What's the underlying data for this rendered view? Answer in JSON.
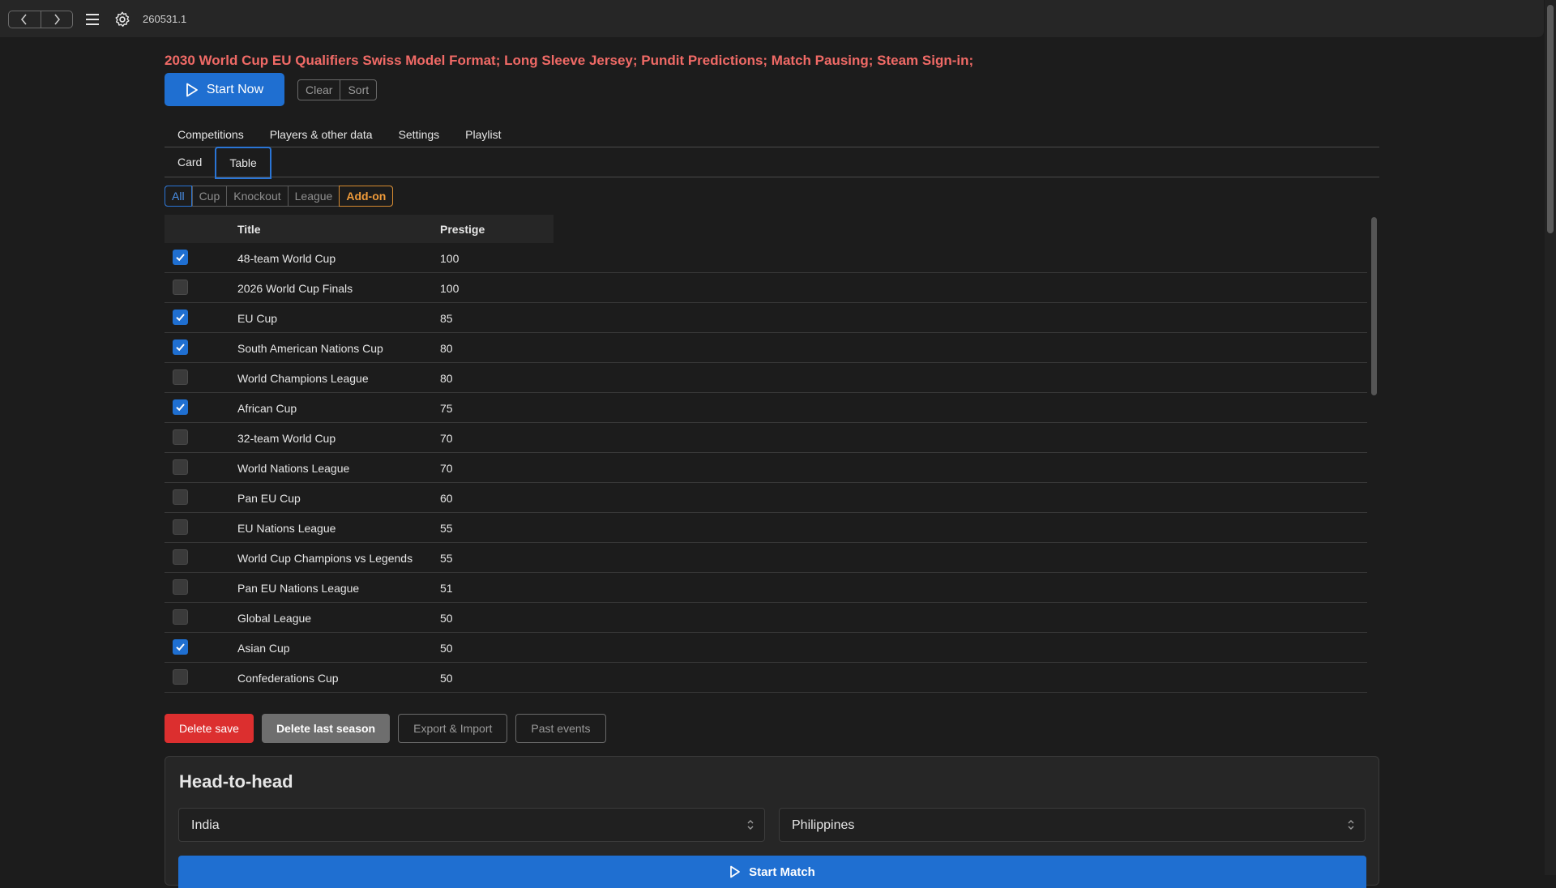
{
  "topbar": {
    "version": "260531.1",
    "icons": [
      "back-icon",
      "forward-icon",
      "menu-icon",
      "gear-icon"
    ]
  },
  "headline": "2030 World Cup EU Qualifiers Swiss Model Format; Long Sleeve Jersey; Pundit Predictions; Match Pausing; Steam Sign-in;",
  "toolbar": {
    "start_now_label": "Start Now",
    "clear_label": "Clear",
    "sort_label": "Sort"
  },
  "tabs": [
    "Competitions",
    "Players & other data",
    "Settings",
    "Playlist"
  ],
  "subtabs": [
    "Card",
    "Table"
  ],
  "active_subtab": "Table",
  "filters": [
    "All",
    "Cup",
    "Knockout",
    "League",
    "Add-on"
  ],
  "table": {
    "columns": [
      "Title",
      "Prestige"
    ],
    "rows": [
      {
        "title": "48-team World Cup",
        "prestige": "100",
        "checked": true
      },
      {
        "title": "2026 World Cup Finals",
        "prestige": "100",
        "checked": false
      },
      {
        "title": "EU Cup",
        "prestige": "85",
        "checked": true
      },
      {
        "title": "South American Nations Cup",
        "prestige": "80",
        "checked": true
      },
      {
        "title": "World Champions League",
        "prestige": "80",
        "checked": false
      },
      {
        "title": "African Cup",
        "prestige": "75",
        "checked": true
      },
      {
        "title": "32-team World Cup",
        "prestige": "70",
        "checked": false
      },
      {
        "title": "World Nations League",
        "prestige": "70",
        "checked": false
      },
      {
        "title": "Pan EU Cup",
        "prestige": "60",
        "checked": false
      },
      {
        "title": "EU Nations League",
        "prestige": "55",
        "checked": false
      },
      {
        "title": "World Cup Champions vs Legends",
        "prestige": "55",
        "checked": false
      },
      {
        "title": "Pan EU Nations League",
        "prestige": "51",
        "checked": false
      },
      {
        "title": "Global League",
        "prestige": "50",
        "checked": false
      },
      {
        "title": "Asian Cup",
        "prestige": "50",
        "checked": true
      },
      {
        "title": "Confederations Cup",
        "prestige": "50",
        "checked": false
      }
    ]
  },
  "actions": {
    "delete_save": "Delete save",
    "delete_last_season": "Delete last season",
    "export_import": "Export & Import",
    "past_events": "Past events"
  },
  "head_to_head": {
    "title": "Head-to-head",
    "team_a": "India",
    "team_b": "Philippines",
    "start_match_label": "Start Match"
  },
  "colors": {
    "accent": "#1f6fd1",
    "headline": "#f06a66",
    "danger": "#dc2f2f",
    "addon": "#ee9a3a"
  }
}
